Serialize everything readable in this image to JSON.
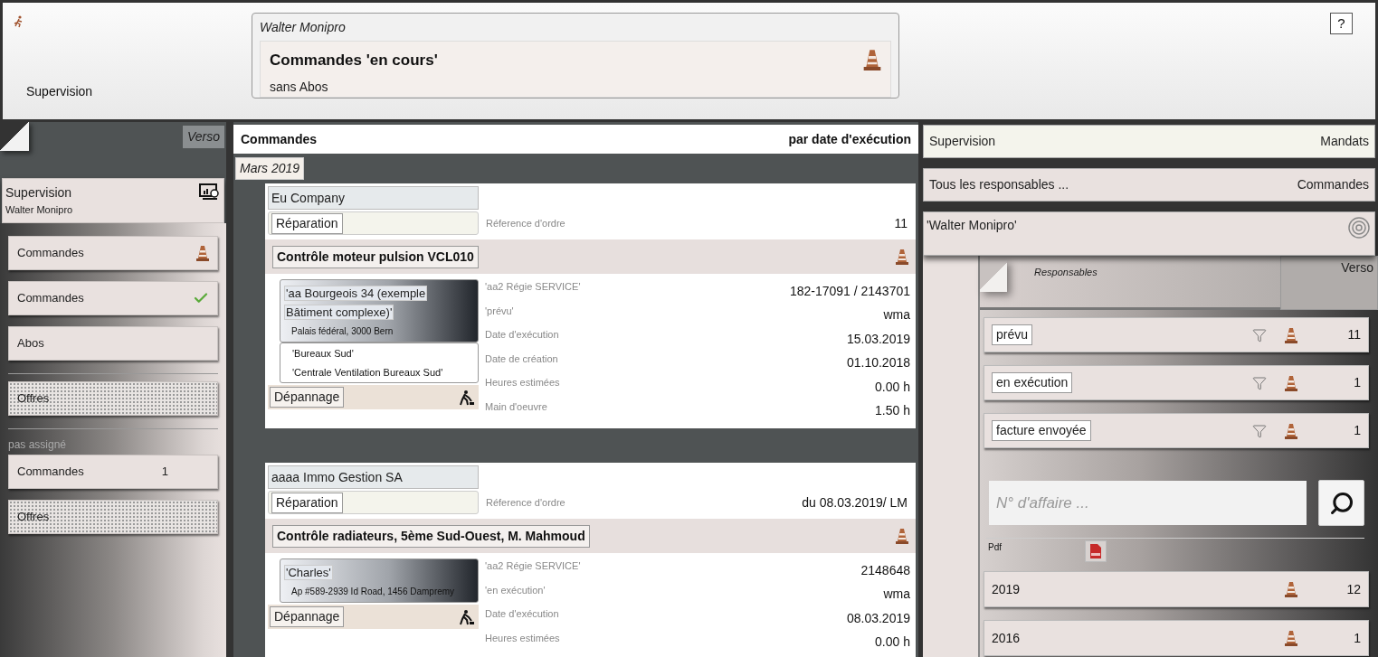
{
  "header": {
    "section": "Supervision",
    "user": "Walter Monipro",
    "title": "Commandes 'en cours'",
    "subtitle": "sans Abos",
    "help": "?"
  },
  "left_panel": {
    "verso": "Verso",
    "profile": {
      "title": "Supervision",
      "user": "Walter Monipro"
    },
    "groups": [
      {
        "items": [
          {
            "kind": "cone",
            "label": "Commandes"
          },
          {
            "kind": "check",
            "label": "Commandes"
          },
          {
            "kind": "plain",
            "label": "Abos"
          }
        ]
      },
      {
        "items": [
          {
            "kind": "dotted",
            "label": "Offres"
          }
        ]
      },
      {
        "heading": "pas assigné",
        "items": [
          {
            "kind": "count",
            "label": "Commandes",
            "count": "1"
          },
          {
            "kind": "dotted",
            "label": "Offres"
          }
        ]
      }
    ]
  },
  "orders": {
    "title": "Commandes",
    "sort": "par date d'exécution",
    "month": "Mars 2019",
    "cards": [
      {
        "company": "Eu Company",
        "type": "Réparation",
        "ref_label": "Réference d'ordre",
        "ref_value": "11",
        "title": "Contrôle moteur pulsion VCL010",
        "location": "'aa Bourgeois 34 (exemple Bâtiment complexe)'",
        "address": "Palais fédéral, 3000 Bern",
        "sublocations": [
          "'Bureaux Sud'",
          "'Centrale Ventilation Bureaux Sud'"
        ],
        "service": "Dépannage",
        "details": [
          {
            "label": "'aa2 Régie SERVICE'",
            "value": "182-17091 / 2143701"
          },
          {
            "label": "'prévu'",
            "value": "wma"
          },
          {
            "label": "Date d'exécution",
            "value": "15.03.2019"
          },
          {
            "label": "Date de création",
            "value": "01.10.2018"
          },
          {
            "label": "Heures estimées",
            "value": "0.00 h"
          },
          {
            "label": "Main d'oeuvre",
            "value": "1.50 h"
          }
        ]
      },
      {
        "company": "aaaa Immo Gestion SA",
        "type": "Réparation",
        "ref_label": "Réference d'ordre",
        "ref_value": "du 08.03.2019/ LM",
        "title": "Contrôle radiateurs, 5ème Sud-Ouest, M. Mahmoud",
        "location": "'Charles'",
        "address": "Ap #589-2939 Id Road, 1456 Dampremy",
        "service": "Dépannage",
        "details": [
          {
            "label": "'aa2 Régie SERVICE'",
            "value": "2148648"
          },
          {
            "label": "'en exécution'",
            "value": "wma"
          },
          {
            "label": "Date d'exécution",
            "value": "08.03.2019"
          },
          {
            "label": "Heures estimées",
            "value": "0.00 h"
          }
        ]
      }
    ]
  },
  "right_panel": {
    "bars": [
      {
        "left": "Supervision",
        "right": "Mandats"
      },
      {
        "left": "Tous les responsables ...",
        "right": "Commandes"
      }
    ],
    "responsible": "'Walter Monipro'",
    "section": "Responsables",
    "verso": "Verso",
    "statuses": [
      {
        "label": "prévu",
        "count": "11"
      },
      {
        "label": "en exécution",
        "count": "1"
      },
      {
        "label": "facture envoyée",
        "count": "1"
      }
    ],
    "search": {
      "placeholder": "N° d'affaire ..."
    },
    "pdf_label": "Pdf",
    "years": [
      {
        "label": "2019",
        "count": "12"
      },
      {
        "label": "2016",
        "count": "1"
      }
    ]
  }
}
